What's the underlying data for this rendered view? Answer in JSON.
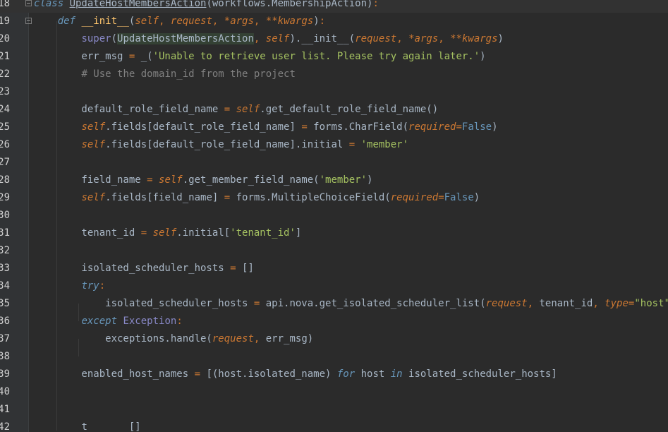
{
  "editor": {
    "language": "python",
    "colors": {
      "background": "#2b2b2b",
      "gutter": "#313335",
      "keyword": "#cc7832",
      "string": "#a5c261",
      "comment": "#808080",
      "text": "#a9b7c6"
    }
  },
  "lines": [
    {
      "num": "18",
      "tokens": [
        {
          "t": "class ",
          "c": "kwb"
        },
        {
          "t": "UpdateHostMembersAction",
          "c": "cls"
        },
        {
          "t": "(workflows.MembershipAction)",
          "c": "ident"
        },
        {
          "t": ":",
          "c": "punc"
        }
      ]
    },
    {
      "num": "19",
      "tokens": [
        {
          "t": "    ",
          "c": "ident"
        },
        {
          "t": "def ",
          "c": "kwb"
        },
        {
          "t": "__init__",
          "c": "fn"
        },
        {
          "t": "(",
          "c": "ident"
        },
        {
          "t": "self",
          "c": "slf"
        },
        {
          "t": ", ",
          "c": "punc"
        },
        {
          "t": "request",
          "c": "prm"
        },
        {
          "t": ", ",
          "c": "punc"
        },
        {
          "t": "*args",
          "c": "prm"
        },
        {
          "t": ", ",
          "c": "punc"
        },
        {
          "t": "**kwargs",
          "c": "prm"
        },
        {
          "t": ")",
          "c": "ident"
        },
        {
          "t": ":",
          "c": "punc"
        }
      ]
    },
    {
      "num": "20",
      "tokens": [
        {
          "t": "        ",
          "c": "ident"
        },
        {
          "t": "super",
          "c": "bi"
        },
        {
          "t": "(",
          "c": "ident"
        },
        {
          "t": "UpdateHostMembersAction",
          "c": "hl"
        },
        {
          "t": ", ",
          "c": "punc"
        },
        {
          "t": "self",
          "c": "slf"
        },
        {
          "t": ").",
          "c": "ident"
        },
        {
          "t": "__init__",
          "c": "ident"
        },
        {
          "t": "(",
          "c": "ident"
        },
        {
          "t": "request",
          "c": "prm"
        },
        {
          "t": ", ",
          "c": "punc"
        },
        {
          "t": "*args",
          "c": "prm"
        },
        {
          "t": ", ",
          "c": "punc"
        },
        {
          "t": "**kwargs",
          "c": "prm"
        },
        {
          "t": ")",
          "c": "ident"
        }
      ]
    },
    {
      "num": "21",
      "tokens": [
        {
          "t": "        err_msg ",
          "c": "ident"
        },
        {
          "t": "= ",
          "c": "punc"
        },
        {
          "t": "_(",
          "c": "ident"
        },
        {
          "t": "'Unable to retrieve user list. Please try again later.'",
          "c": "str"
        },
        {
          "t": ")",
          "c": "ident"
        }
      ]
    },
    {
      "num": "22",
      "tokens": [
        {
          "t": "        ",
          "c": "ident"
        },
        {
          "t": "# Use the domain_id from the project",
          "c": "com"
        }
      ]
    },
    {
      "num": "23",
      "tokens": []
    },
    {
      "num": "24",
      "tokens": [
        {
          "t": "        default_role_field_name ",
          "c": "ident"
        },
        {
          "t": "= ",
          "c": "punc"
        },
        {
          "t": "self",
          "c": "slf"
        },
        {
          "t": ".get_default_role_field_name()",
          "c": "ident"
        }
      ]
    },
    {
      "num": "25",
      "tokens": [
        {
          "t": "        ",
          "c": "ident"
        },
        {
          "t": "self",
          "c": "slf"
        },
        {
          "t": ".fields[default_role_field_name] ",
          "c": "ident"
        },
        {
          "t": "= ",
          "c": "punc"
        },
        {
          "t": "forms.CharField(",
          "c": "ident"
        },
        {
          "t": "required",
          "c": "prm"
        },
        {
          "t": "=",
          "c": "punc"
        },
        {
          "t": "False",
          "c": "true-kw"
        },
        {
          "t": ")",
          "c": "ident"
        }
      ]
    },
    {
      "num": "26",
      "tokens": [
        {
          "t": "        ",
          "c": "ident"
        },
        {
          "t": "self",
          "c": "slf"
        },
        {
          "t": ".fields[default_role_field_name].initial ",
          "c": "ident"
        },
        {
          "t": "= ",
          "c": "punc"
        },
        {
          "t": "'member'",
          "c": "str"
        }
      ]
    },
    {
      "num": "27",
      "tokens": []
    },
    {
      "num": "28",
      "tokens": [
        {
          "t": "        field_name ",
          "c": "ident"
        },
        {
          "t": "= ",
          "c": "punc"
        },
        {
          "t": "self",
          "c": "slf"
        },
        {
          "t": ".get_member_field_name(",
          "c": "ident"
        },
        {
          "t": "'member'",
          "c": "str"
        },
        {
          "t": ")",
          "c": "ident"
        }
      ]
    },
    {
      "num": "29",
      "tokens": [
        {
          "t": "        ",
          "c": "ident"
        },
        {
          "t": "self",
          "c": "slf"
        },
        {
          "t": ".fields[field_name] ",
          "c": "ident"
        },
        {
          "t": "= ",
          "c": "punc"
        },
        {
          "t": "forms.MultipleChoiceField(",
          "c": "ident"
        },
        {
          "t": "required",
          "c": "prm"
        },
        {
          "t": "=",
          "c": "punc"
        },
        {
          "t": "False",
          "c": "true-kw"
        },
        {
          "t": ")",
          "c": "ident"
        }
      ]
    },
    {
      "num": "30",
      "tokens": []
    },
    {
      "num": "31",
      "tokens": [
        {
          "t": "        tenant_id ",
          "c": "ident"
        },
        {
          "t": "= ",
          "c": "punc"
        },
        {
          "t": "self",
          "c": "slf"
        },
        {
          "t": ".initial[",
          "c": "ident"
        },
        {
          "t": "'tenant_id'",
          "c": "str"
        },
        {
          "t": "]",
          "c": "ident"
        }
      ]
    },
    {
      "num": "32",
      "tokens": []
    },
    {
      "num": "33",
      "tokens": [
        {
          "t": "        isolated_scheduler_hosts ",
          "c": "ident"
        },
        {
          "t": "= ",
          "c": "punc"
        },
        {
          "t": "[]",
          "c": "ident"
        }
      ]
    },
    {
      "num": "34",
      "tokens": [
        {
          "t": "        ",
          "c": "ident"
        },
        {
          "t": "try",
          "c": "kwb"
        },
        {
          "t": ":",
          "c": "punc"
        }
      ]
    },
    {
      "num": "35",
      "tokens": [
        {
          "t": "            isolated_scheduler_hosts ",
          "c": "ident"
        },
        {
          "t": "= ",
          "c": "punc"
        },
        {
          "t": "api.nova.get_isolated_scheduler_list(",
          "c": "ident"
        },
        {
          "t": "request",
          "c": "prm"
        },
        {
          "t": ", ",
          "c": "punc"
        },
        {
          "t": "tenant_id",
          "c": "ident"
        },
        {
          "t": ", ",
          "c": "punc"
        },
        {
          "t": "type",
          "c": "prm"
        },
        {
          "t": "=",
          "c": "punc"
        },
        {
          "t": "\"host\"",
          "c": "str"
        },
        {
          "t": ")",
          "c": "ident"
        }
      ]
    },
    {
      "num": "36",
      "tokens": [
        {
          "t": "        ",
          "c": "ident"
        },
        {
          "t": "except ",
          "c": "kwb"
        },
        {
          "t": "Exception",
          "c": "bi"
        },
        {
          "t": ":",
          "c": "punc"
        }
      ]
    },
    {
      "num": "37",
      "tokens": [
        {
          "t": "            exceptions.handle(",
          "c": "ident"
        },
        {
          "t": "request",
          "c": "prm"
        },
        {
          "t": ", ",
          "c": "punc"
        },
        {
          "t": "err_msg",
          "c": "ident"
        },
        {
          "t": ")",
          "c": "ident"
        }
      ]
    },
    {
      "num": "38",
      "tokens": []
    },
    {
      "num": "39",
      "tokens": [
        {
          "t": "        enabled_host_names ",
          "c": "ident"
        },
        {
          "t": "= ",
          "c": "punc"
        },
        {
          "t": "[(host.isolated_name) ",
          "c": "ident"
        },
        {
          "t": "for ",
          "c": "kwb"
        },
        {
          "t": "host ",
          "c": "ident"
        },
        {
          "t": "in ",
          "c": "kwb"
        },
        {
          "t": "isolated_scheduler_hosts]",
          "c": "ident"
        }
      ]
    },
    {
      "num": "40",
      "tokens": []
    },
    {
      "num": "41",
      "tokens": []
    },
    {
      "num": "42",
      "tokens": [
        {
          "t": "        ",
          "c": "ident"
        },
        {
          "t": "t",
          "c": "ident"
        },
        {
          "t": "       []",
          "c": "ident"
        }
      ]
    }
  ]
}
